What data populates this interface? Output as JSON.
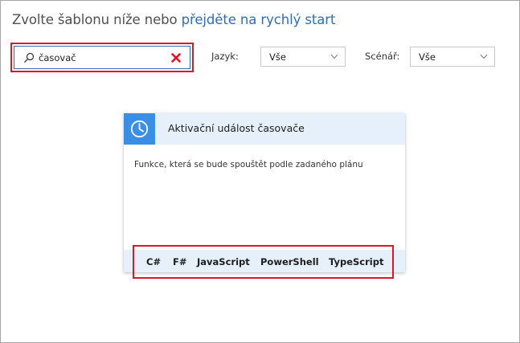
{
  "header": {
    "text": "Zvolte šablonu níže nebo",
    "link": "přejděte na rychlý start"
  },
  "search": {
    "value": "časovač",
    "icon": "search-icon",
    "clear_icon": "clear-icon"
  },
  "filters": {
    "language": {
      "label": "Jazyk:",
      "selected": "Vše"
    },
    "scenario": {
      "label": "Scénář:",
      "selected": "Vše"
    }
  },
  "template_card": {
    "icon": "clock-icon",
    "title": "Aktivační událost časovače",
    "description": "Funkce, která se bude spouštět podle zadaného plánu",
    "languages": [
      "C#",
      "F#",
      "JavaScript",
      "PowerShell",
      "TypeScript"
    ]
  },
  "colors": {
    "accent": "#3a8ee6",
    "link": "#2f6db5",
    "highlight": "#d9182e",
    "card_band": "#e6f0fb",
    "clear_x": "#e81123"
  }
}
